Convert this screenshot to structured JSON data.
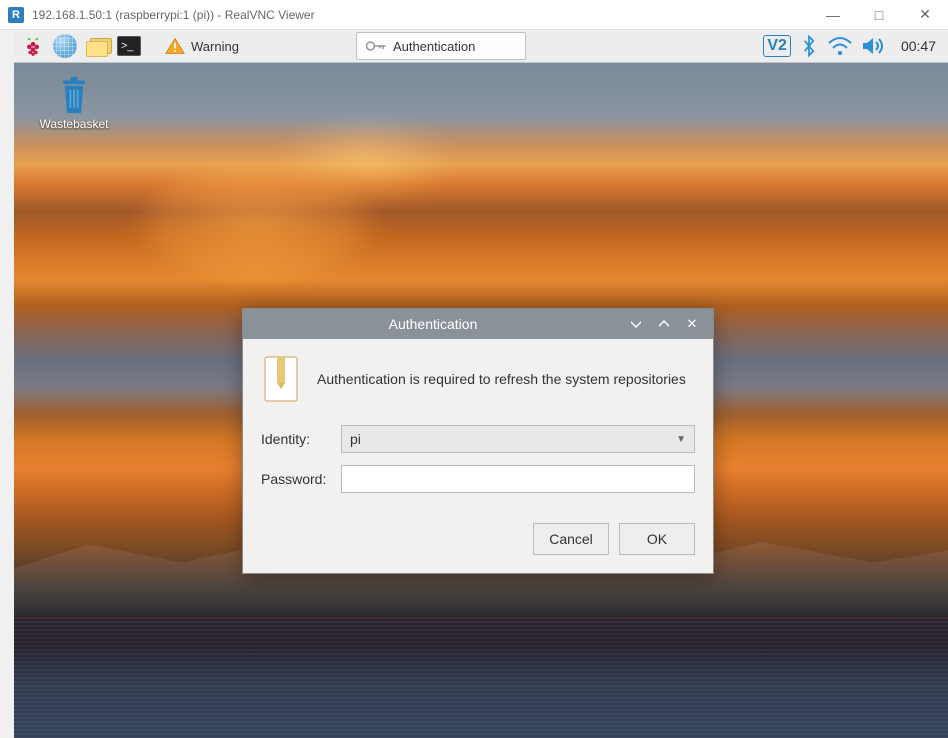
{
  "window": {
    "title": "192.168.1.50:1 (raspberrypi:1 (pi)) - RealVNC Viewer",
    "app_icon_letter": "R"
  },
  "taskbar": {
    "items": [
      {
        "label": "Warning"
      },
      {
        "label": "Authentication"
      }
    ],
    "tray": {
      "vnc_label": "V2",
      "clock": "00:47"
    }
  },
  "desktop": {
    "icons": [
      {
        "label": "Wastebasket"
      }
    ]
  },
  "dialog": {
    "title": "Authentication",
    "message": "Authentication is required to refresh the system repositories",
    "identity_label": "Identity:",
    "identity_value": "pi",
    "password_label": "Password:",
    "password_value": "",
    "buttons": {
      "cancel": "Cancel",
      "ok": "OK"
    }
  }
}
